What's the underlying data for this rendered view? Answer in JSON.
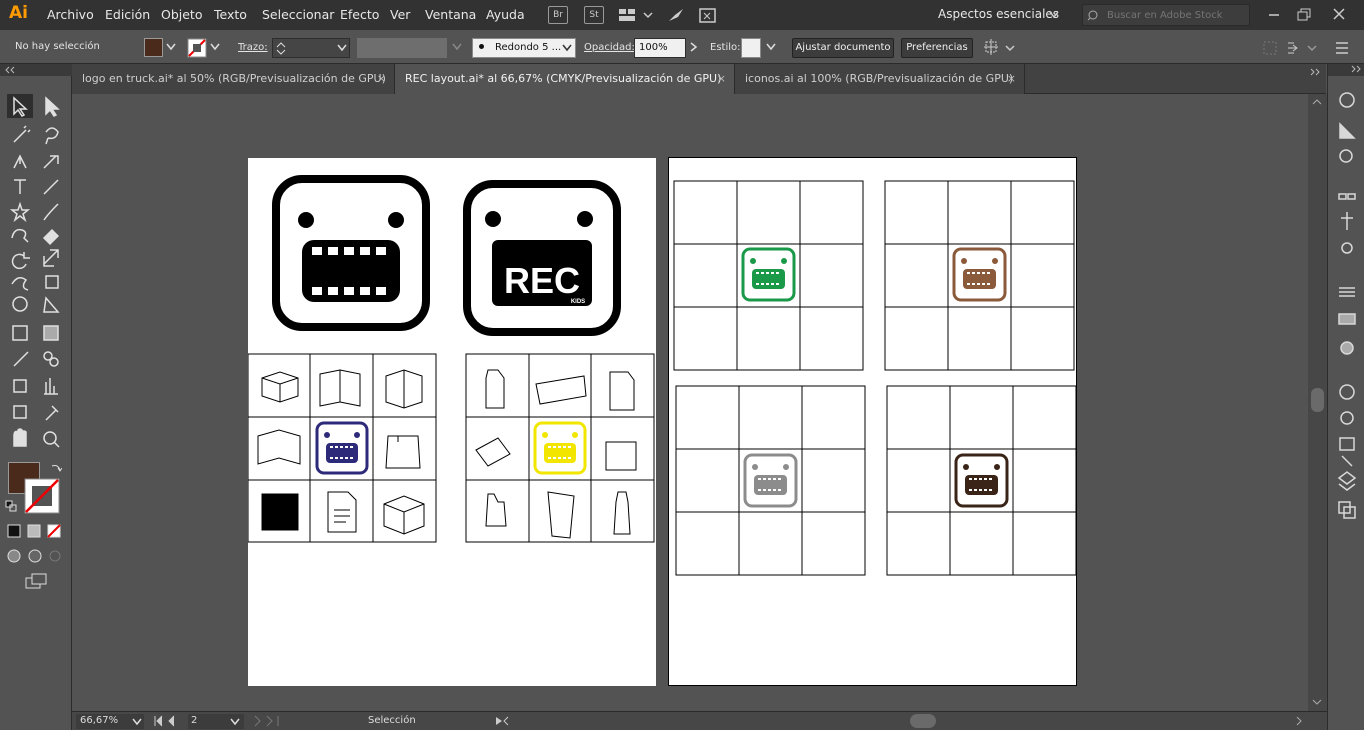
{
  "app": {
    "logo": "Ai"
  },
  "menu": [
    "Archivo",
    "Edición",
    "Objeto",
    "Texto",
    "Seleccionar",
    "Efecto",
    "Ver",
    "Ventana",
    "Ayuda"
  ],
  "bridge_labels": {
    "br": "Br",
    "st": "St"
  },
  "workspace": "Aspectos esenciales",
  "search": {
    "placeholder": "Buscar en Adobe Stock"
  },
  "control": {
    "selection_status": "No hay selección",
    "stroke_label": "Trazo:",
    "brush": "Redondo 5 ...",
    "opacity_label": "Opacidad:",
    "opacity_value": "100%",
    "style_label": "Estilo:",
    "adjust_btn": "Ajustar documento",
    "prefs_btn": "Preferencias",
    "fill_color": "#4a2a1a"
  },
  "tabs": [
    {
      "label": "logo en truck.ai* al 50% (RGB/Previsualización de GPU)",
      "close": "×"
    },
    {
      "label": "REC layout.ai* al 66,67% (CMYK/Previsualización de GPU)",
      "close": "×"
    },
    {
      "label": "iconos.ai al 100% (RGB/Previsualización de GPU)",
      "close": "×"
    }
  ],
  "artwork": {
    "rec_text": "REC",
    "kids_text": "KIDS",
    "mascot_colors": {
      "purple": "#2e2a7a",
      "yellow": "#f2e600",
      "green": "#1a9a48",
      "tan": "#8b5a3a",
      "gray": "#8c8c8c",
      "dark_brown": "#3a2418"
    }
  },
  "status": {
    "zoom": "66,67%",
    "artboard": "2",
    "tool": "Selección"
  }
}
